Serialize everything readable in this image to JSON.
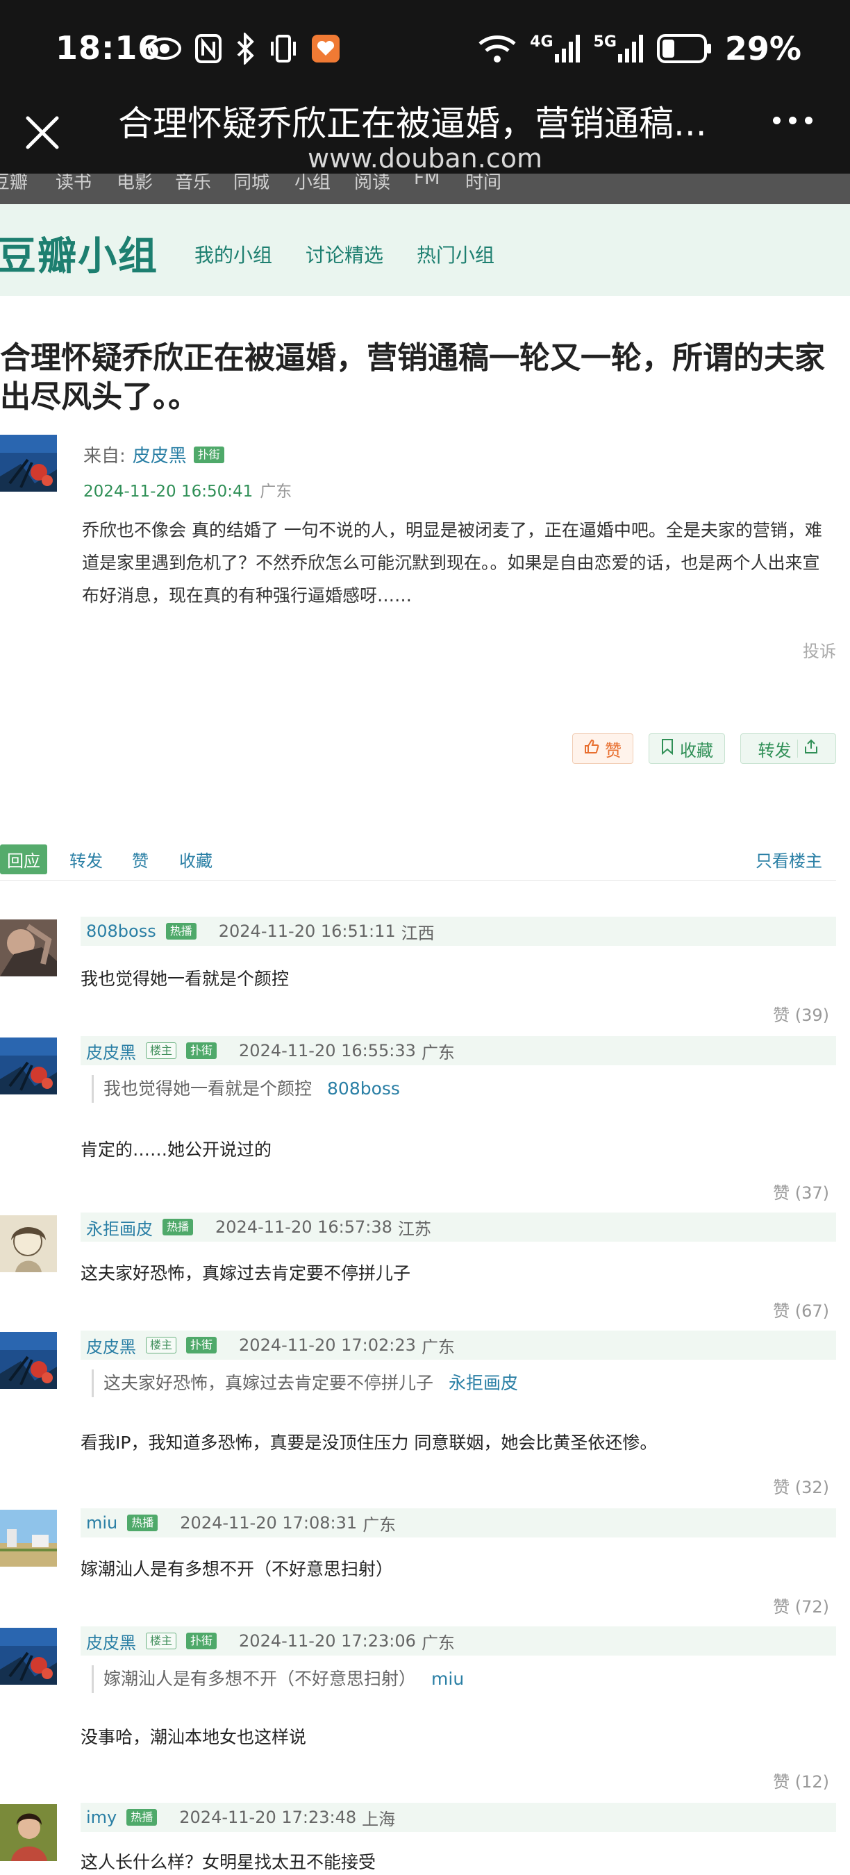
{
  "status_bar": {
    "time": "18:16",
    "battery_percent": "29%",
    "network_labels": [
      "4G",
      "5G"
    ]
  },
  "browser": {
    "page_title": "合理怀疑乔欣正在被逼婚，营销通稿...",
    "url": "www.douban.com"
  },
  "site_nav": [
    "豆瓣",
    "读书",
    "电影",
    "音乐",
    "同城",
    "小组",
    "阅读",
    "FM",
    "时间"
  ],
  "group_header": {
    "logo": "豆瓣小组",
    "nav": [
      "我的小组",
      "讨论精选",
      "热门小组"
    ]
  },
  "topic": {
    "title": "合理怀疑乔欣正在被逼婚，营销通稿一轮又一轮，所谓的夫家 出尽风头了。。",
    "from_label": "来自:",
    "author": "皮皮黑",
    "author_tag": "扑街",
    "datetime": "2024-11-20 16:50:41",
    "location": "广东",
    "body": "乔欣也不像会 真的结婚了 一句不说的人，明显是被闭麦了，正在逼婚中吧。全是夫家的营销，难道是家里遇到危机了？不然乔欣怎么可能沉默到现在。。如果是自由恋爱的话，也是两个人出来宣布好消息，现在真的有种强行逼婚感呀……",
    "report": "投诉",
    "actions": {
      "like": "赞",
      "collect": "收藏",
      "share": "转发"
    }
  },
  "reply_bar": {
    "items": [
      "回应",
      "转发",
      "赞",
      "收藏"
    ],
    "only_op": "只看楼主"
  },
  "comments": [
    {
      "name": "808boss",
      "tags": [
        "热播"
      ],
      "datetime": "2024-11-20 16:51:11",
      "location": "江西",
      "text": "我也觉得她一看就是个颜控",
      "likes": "赞 (39)"
    },
    {
      "name": "皮皮黑",
      "tags": [
        "楼主",
        "扑街"
      ],
      "datetime": "2024-11-20 16:55:33",
      "location": "广东",
      "quote": "我也觉得她一看就是个颜控",
      "quote_author": "808boss",
      "text": "肯定的……她公开说过的",
      "likes": "赞 (37)"
    },
    {
      "name": "永拒画皮",
      "tags": [
        "热播"
      ],
      "datetime": "2024-11-20 16:57:38",
      "location": "江苏",
      "text": "这夫家好恐怖，真嫁过去肯定要不停拼儿子",
      "likes": "赞 (67)"
    },
    {
      "name": "皮皮黑",
      "tags": [
        "楼主",
        "扑街"
      ],
      "datetime": "2024-11-20 17:02:23",
      "location": "广东",
      "quote": "这夫家好恐怖，真嫁过去肯定要不停拼儿子",
      "quote_author": "永拒画皮",
      "text": "看我IP，我知道多恐怖，真要是没顶住压力 同意联姻，她会比黄圣依还惨。",
      "likes": "赞 (32)"
    },
    {
      "name": "miu",
      "tags": [
        "热播"
      ],
      "datetime": "2024-11-20 17:08:31",
      "location": "广东",
      "text": "嫁潮汕人是有多想不开（不好意思扫射）",
      "likes": "赞 (72)"
    },
    {
      "name": "皮皮黑",
      "tags": [
        "楼主",
        "扑街"
      ],
      "datetime": "2024-11-20 17:23:06",
      "location": "广东",
      "quote": "嫁潮汕人是有多想不开（不好意思扫射）",
      "quote_author": "miu",
      "text": "没事哈，潮汕本地女也这样说",
      "likes": "赞 (12)"
    },
    {
      "name": "imy",
      "tags": [
        "热播"
      ],
      "datetime": "2024-11-20 17:23:48",
      "location": "上海",
      "text": "这人长什么样？女明星找太丑不能接受",
      "likes": ""
    }
  ],
  "colors": {
    "douban_green": "#1d7f70",
    "link_blue": "#2a7fa5",
    "tag_green": "#4fa96a",
    "like_orange": "#e86f2f",
    "comment_header_bg": "#f0f7f2"
  },
  "icons": [
    "close-icon",
    "more-icon",
    "eye-icon",
    "nfc-icon",
    "bluetooth-icon",
    "vibrate-icon",
    "app-badge-icon",
    "wifi-icon",
    "signal-icon",
    "battery-icon",
    "thumbs-up-icon",
    "bookmark-icon",
    "share-icon"
  ]
}
